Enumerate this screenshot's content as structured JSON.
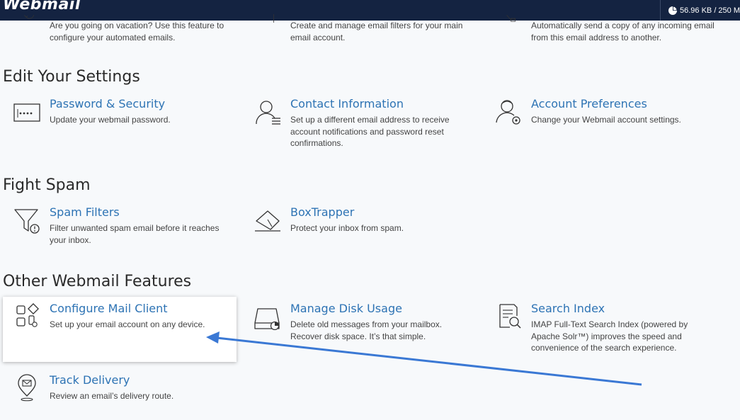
{
  "header": {
    "logo": "Webmail",
    "quota": "56.96 KB / 250 M"
  },
  "top_row": [
    {
      "desc": "Are you going on vacation? Use this feature to configure your automated emails."
    },
    {
      "desc": "Create and manage email filters for your main email account."
    },
    {
      "desc": "Automatically send a copy of any incoming email from this email address to another."
    }
  ],
  "sections": {
    "settings": {
      "title": "Edit Your Settings",
      "items": [
        {
          "title": "Password & Security",
          "desc": "Update your webmail password.",
          "icon": "password-icon"
        },
        {
          "title": "Contact Information",
          "desc": "Set up a different email address to receive account notifications and password reset confirmations.",
          "icon": "contact-icon"
        },
        {
          "title": "Account Preferences",
          "desc": "Change your Webmail account settings.",
          "icon": "account-preferences-icon"
        }
      ]
    },
    "spam": {
      "title": "Fight Spam",
      "items": [
        {
          "title": "Spam Filters",
          "desc": "Filter unwanted spam email before it reaches your inbox.",
          "icon": "spam-filter-icon"
        },
        {
          "title": "BoxTrapper",
          "desc": "Protect your inbox from spam.",
          "icon": "boxtrapper-icon"
        }
      ]
    },
    "other": {
      "title": "Other Webmail Features",
      "items": [
        {
          "title": "Configure Mail Client",
          "desc": "Set up your email account on any device.",
          "icon": "configure-mail-client-icon"
        },
        {
          "title": "Manage Disk Usage",
          "desc": "Delete old messages from your mailbox. Recover disk space. It’s that simple.",
          "icon": "disk-usage-icon"
        },
        {
          "title": "Search Index",
          "desc": "IMAP Full-Text Search Index (powered by Apache Solr™) improves the speed and convenience of the search experience.",
          "icon": "search-index-icon"
        },
        {
          "title": "Track Delivery",
          "desc": "Review an email’s delivery route.",
          "icon": "track-delivery-icon"
        }
      ]
    }
  },
  "colors": {
    "header_bg": "#142341",
    "link": "#2d73b4",
    "annotation_arrow": "#3a78d4"
  }
}
